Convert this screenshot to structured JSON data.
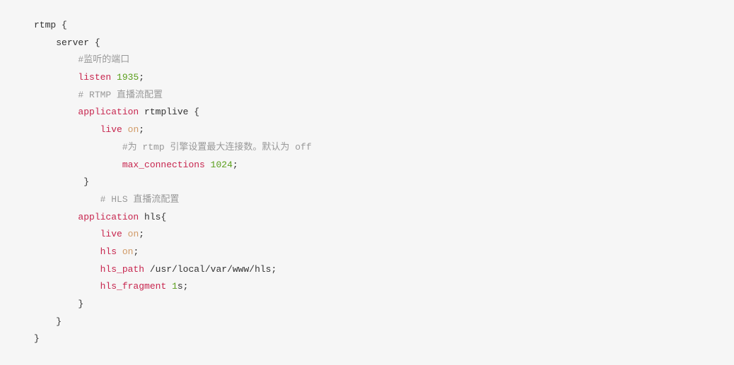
{
  "lines": [
    {
      "indent": 0,
      "tokens": [
        {
          "cls": "plain",
          "txt": "rtmp "
        },
        {
          "cls": "brace",
          "txt": "{"
        }
      ]
    },
    {
      "indent": 1,
      "tokens": [
        {
          "cls": "plain",
          "txt": "server "
        },
        {
          "cls": "brace",
          "txt": "{"
        }
      ]
    },
    {
      "indent": 2,
      "tokens": [
        {
          "cls": "comment",
          "txt": "#监听的端口"
        }
      ]
    },
    {
      "indent": 2,
      "tokens": [
        {
          "cls": "keyword",
          "txt": "listen"
        },
        {
          "cls": "plain",
          "txt": " "
        },
        {
          "cls": "number",
          "txt": "1935"
        },
        {
          "cls": "plain",
          "txt": ";"
        }
      ]
    },
    {
      "indent": 2,
      "tokens": [
        {
          "cls": "comment",
          "txt": "# RTMP 直播流配置"
        }
      ]
    },
    {
      "indent": 2,
      "tokens": [
        {
          "cls": "keyword",
          "txt": "application"
        },
        {
          "cls": "plain",
          "txt": " rtmplive "
        },
        {
          "cls": "brace",
          "txt": "{"
        }
      ]
    },
    {
      "indent": 3,
      "tokens": [
        {
          "cls": "keyword",
          "txt": "live"
        },
        {
          "cls": "plain",
          "txt": " "
        },
        {
          "cls": "value",
          "txt": "on"
        },
        {
          "cls": "plain",
          "txt": ";"
        }
      ]
    },
    {
      "indent": 4,
      "tokens": [
        {
          "cls": "comment",
          "txt": "#为 rtmp 引擎设置最大连接数。默认为 off"
        }
      ]
    },
    {
      "indent": 4,
      "tokens": [
        {
          "cls": "keyword",
          "txt": "max_connections"
        },
        {
          "cls": "plain",
          "txt": " "
        },
        {
          "cls": "number",
          "txt": "1024"
        },
        {
          "cls": "plain",
          "txt": ";"
        }
      ]
    },
    {
      "indent": 2,
      "tokens": [
        {
          "cls": "plain",
          "txt": " "
        },
        {
          "cls": "brace",
          "txt": "}"
        }
      ]
    },
    {
      "indent": 3,
      "tokens": [
        {
          "cls": "comment",
          "txt": "# HLS 直播流配置"
        }
      ]
    },
    {
      "indent": 2,
      "tokens": [
        {
          "cls": "keyword",
          "txt": "application"
        },
        {
          "cls": "plain",
          "txt": " hls"
        },
        {
          "cls": "brace",
          "txt": "{"
        }
      ]
    },
    {
      "indent": 3,
      "tokens": [
        {
          "cls": "keyword",
          "txt": "live"
        },
        {
          "cls": "plain",
          "txt": " "
        },
        {
          "cls": "value",
          "txt": "on"
        },
        {
          "cls": "plain",
          "txt": ";"
        }
      ]
    },
    {
      "indent": 3,
      "tokens": [
        {
          "cls": "keyword",
          "txt": "hls"
        },
        {
          "cls": "plain",
          "txt": " "
        },
        {
          "cls": "value",
          "txt": "on"
        },
        {
          "cls": "plain",
          "txt": ";"
        }
      ]
    },
    {
      "indent": 3,
      "tokens": [
        {
          "cls": "keyword",
          "txt": "hls_path"
        },
        {
          "cls": "plain",
          "txt": " /usr/local/var/www/hls;"
        }
      ]
    },
    {
      "indent": 3,
      "tokens": [
        {
          "cls": "keyword",
          "txt": "hls_fragment"
        },
        {
          "cls": "plain",
          "txt": " "
        },
        {
          "cls": "number",
          "txt": "1"
        },
        {
          "cls": "plain",
          "txt": "s;"
        }
      ]
    },
    {
      "indent": 2,
      "tokens": [
        {
          "cls": "brace",
          "txt": "}"
        }
      ]
    },
    {
      "indent": 1,
      "tokens": [
        {
          "cls": "brace",
          "txt": "}"
        }
      ]
    },
    {
      "indent": 0,
      "tokens": [
        {
          "cls": "brace",
          "txt": "}"
        }
      ]
    }
  ],
  "indent_unit": "    "
}
